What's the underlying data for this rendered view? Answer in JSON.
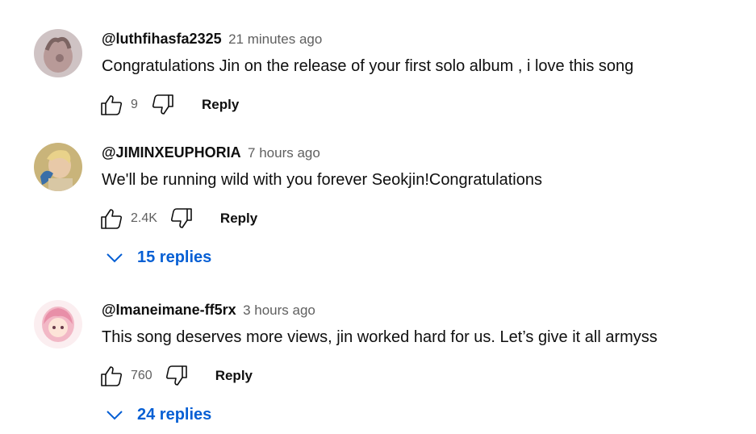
{
  "comments": [
    {
      "author": "@luthfihasfa2325",
      "time": "21 minutes ago",
      "text": "Congratulations Jin on the release of your first solo album , i love this song",
      "likes": "9",
      "reply_label": "Reply",
      "replies_label": ""
    },
    {
      "author": "@JIMINXEUPHORIA",
      "time": "7 hours ago",
      "text": "We'll be running wild with you forever Seokjin!Congratulations",
      "likes": "2.4K",
      "reply_label": "Reply",
      "replies_label": "15 replies"
    },
    {
      "author": "@Imaneimane-ff5rx",
      "time": "3 hours ago",
      "text": "This song deserves more views, jin worked hard for us. Let’s give it all armyss",
      "likes": "760",
      "reply_label": "Reply",
      "replies_label": "24 replies"
    }
  ],
  "colors": {
    "link_blue": "#065fd4",
    "meta_gray": "#606060",
    "text": "#0f0f0f"
  },
  "icons": [
    "thumb-up-icon",
    "thumb-down-icon",
    "chevron-down-icon",
    "avatar-image"
  ]
}
